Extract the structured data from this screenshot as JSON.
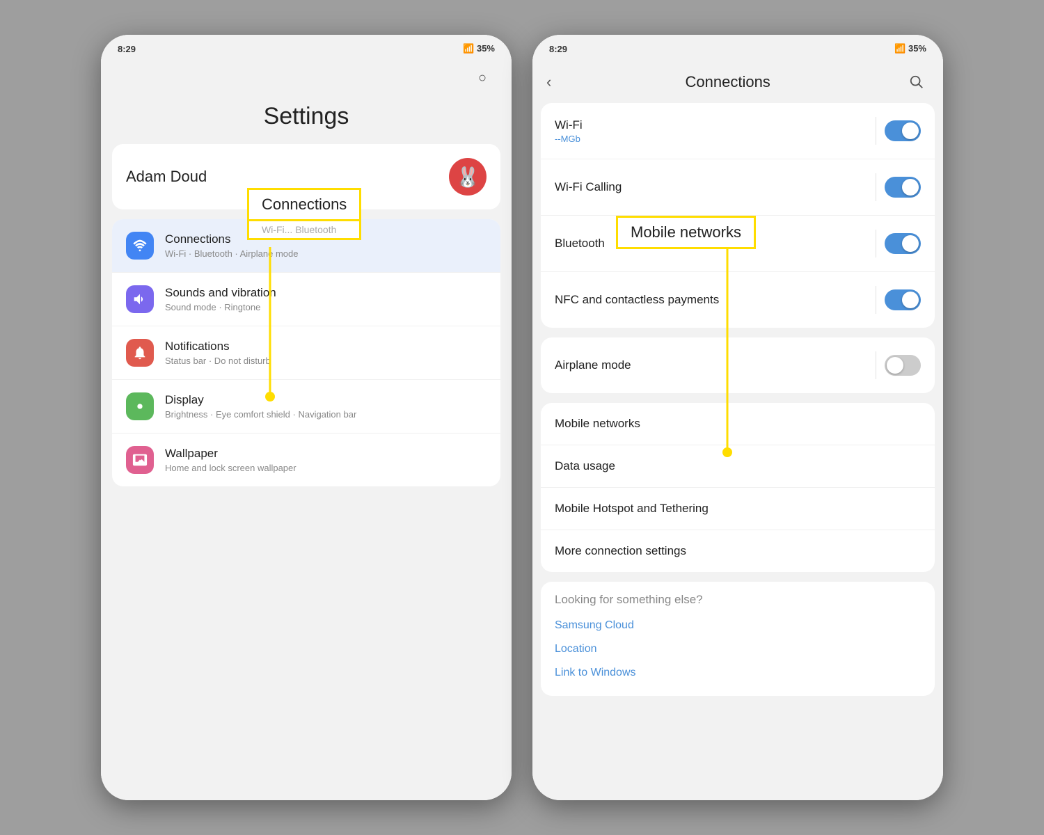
{
  "left_phone": {
    "status_bar": {
      "time": "8:29",
      "signal": "35%"
    },
    "title": "Settings",
    "profile": {
      "name": "Adam Doud",
      "avatar_emoji": "🐰"
    },
    "annotation": {
      "label": "Connections",
      "subtitle": "Wi-Fi · Bluetooth"
    },
    "items": [
      {
        "id": "connections",
        "icon": "📶",
        "icon_class": "icon-blue",
        "title": "Connections",
        "subtitle": "Wi-Fi · Bluetooth · Airplane mode"
      },
      {
        "id": "sounds",
        "icon": "🔔",
        "icon_class": "icon-purple",
        "title": "Sounds and vibration",
        "subtitle": "Sound mode · Ringtone"
      },
      {
        "id": "notifications",
        "icon": "🔕",
        "icon_class": "icon-red",
        "title": "Notifications",
        "subtitle": "Status bar · Do not disturb"
      },
      {
        "id": "display",
        "icon": "☀️",
        "icon_class": "icon-green",
        "title": "Display",
        "subtitle": "Brightness · Eye comfort shield · Navigation bar"
      },
      {
        "id": "wallpaper",
        "icon": "🖼️",
        "icon_class": "icon-pink",
        "title": "Wallpaper",
        "subtitle": "Home and lock screen wallpaper"
      }
    ]
  },
  "right_phone": {
    "status_bar": {
      "time": "8:29",
      "signal": "35%"
    },
    "header": {
      "back_label": "‹",
      "title": "Connections",
      "search_icon": "🔍"
    },
    "annotation": {
      "label": "Mobile networks"
    },
    "toggle_items": [
      {
        "id": "wifi",
        "title": "Wi-Fi",
        "subtitle": "--MGb",
        "has_subtitle": true,
        "toggle": true,
        "toggle_on": true
      },
      {
        "id": "wifi-calling",
        "title": "Wi-Fi Calling",
        "subtitle": "",
        "has_subtitle": false,
        "toggle": true,
        "toggle_on": true
      },
      {
        "id": "bluetooth",
        "title": "Bluetooth",
        "subtitle": "",
        "has_subtitle": false,
        "toggle": true,
        "toggle_on": true
      },
      {
        "id": "nfc",
        "title": "NFC and contactless payments",
        "subtitle": "",
        "has_subtitle": false,
        "toggle": true,
        "toggle_on": true
      }
    ],
    "simple_items": [
      {
        "id": "airplane",
        "title": "Airplane mode",
        "toggle": true,
        "toggle_on": false
      }
    ],
    "list_items": [
      {
        "id": "mobile-networks",
        "title": "Mobile networks"
      },
      {
        "id": "data-usage",
        "title": "Data usage"
      },
      {
        "id": "hotspot",
        "title": "Mobile Hotspot and Tethering"
      },
      {
        "id": "more-connections",
        "title": "More connection settings"
      }
    ],
    "looking_section": {
      "title": "Looking for something else?",
      "links": [
        {
          "id": "samsung-cloud",
          "label": "Samsung Cloud"
        },
        {
          "id": "location",
          "label": "Location"
        },
        {
          "id": "link-to-windows",
          "label": "Link to Windows"
        }
      ]
    }
  }
}
